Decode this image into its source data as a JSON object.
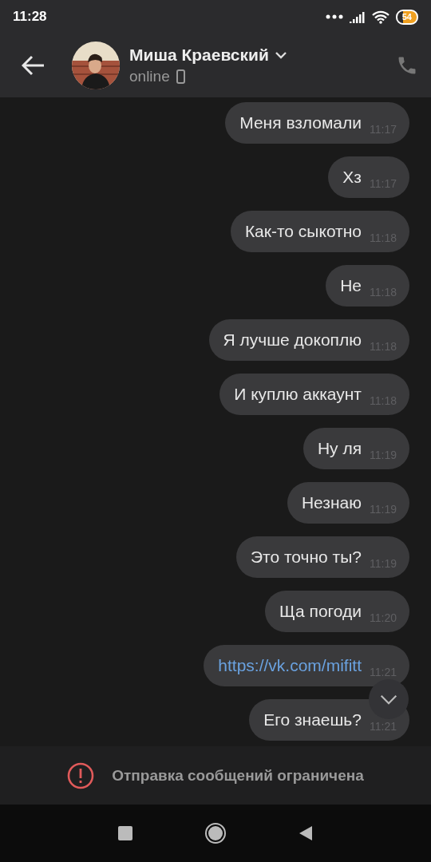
{
  "status_bar": {
    "time": "11:28",
    "battery": "54"
  },
  "header": {
    "name": "Миша Краевский",
    "status": "online"
  },
  "messages": [
    {
      "kind": "text",
      "text": "Меня взломали",
      "time": "11:17"
    },
    {
      "kind": "text",
      "text": "Хз",
      "time": "11:17"
    },
    {
      "kind": "text",
      "text": "Как-то сыкотно",
      "time": "11:18"
    },
    {
      "kind": "text",
      "text": "Не",
      "time": "11:18"
    },
    {
      "kind": "text",
      "text": "Я лучше докоплю",
      "time": "11:18"
    },
    {
      "kind": "text",
      "text": "И куплю аккаунт",
      "time": "11:18"
    },
    {
      "kind": "text",
      "text": "Ну ля",
      "time": "11:19"
    },
    {
      "kind": "text",
      "text": "Незнаю",
      "time": "11:19"
    },
    {
      "kind": "text",
      "text": "Это точно ты?",
      "time": "11:19"
    },
    {
      "kind": "text",
      "text": "Ща погоди",
      "time": "11:20"
    },
    {
      "kind": "link",
      "text": "https://vk.com/mifitt",
      "time": "11:21"
    },
    {
      "kind": "text",
      "text": "Его знаешь?",
      "time": "11:21"
    }
  ],
  "restriction": {
    "text": "Отправка сообщений ограничена"
  }
}
